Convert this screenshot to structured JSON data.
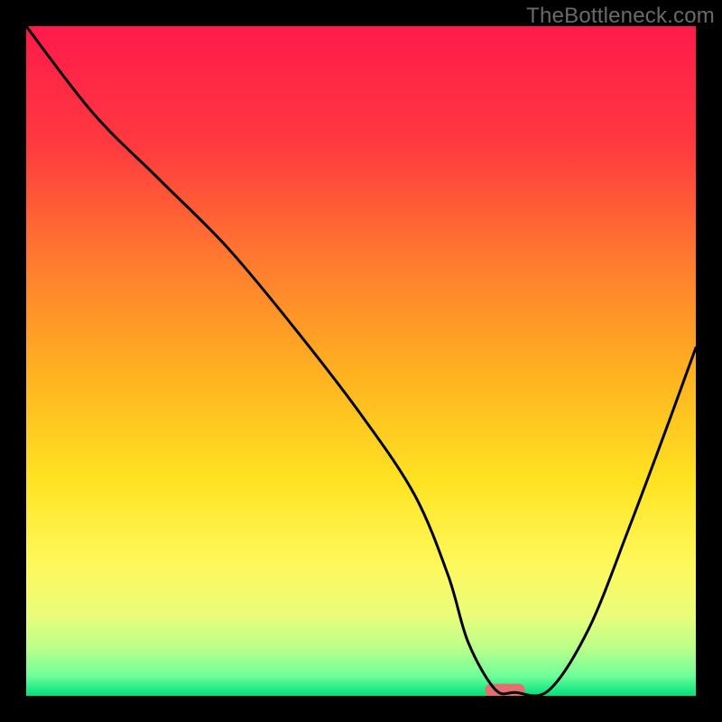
{
  "watermark": "TheBottleneck.com",
  "chart_data": {
    "type": "line",
    "title": "",
    "xlabel": "",
    "ylabel": "",
    "xlim": [
      0,
      100
    ],
    "ylim": [
      0,
      100
    ],
    "grid": false,
    "background_gradient_stops": [
      {
        "offset": 0.0,
        "color": "#ff1a4b"
      },
      {
        "offset": 0.18,
        "color": "#ff3a3f"
      },
      {
        "offset": 0.35,
        "color": "#ff7a2f"
      },
      {
        "offset": 0.52,
        "color": "#ffb220"
      },
      {
        "offset": 0.68,
        "color": "#ffe322"
      },
      {
        "offset": 0.8,
        "color": "#fff85a"
      },
      {
        "offset": 0.88,
        "color": "#eafd7a"
      },
      {
        "offset": 0.93,
        "color": "#b8ff8a"
      },
      {
        "offset": 0.97,
        "color": "#6fff9a"
      },
      {
        "offset": 1.0,
        "color": "#00e07a"
      }
    ],
    "series": [
      {
        "name": "bottleneck-curve",
        "x": [
          0,
          10,
          20,
          30,
          40,
          50,
          58,
          63,
          66,
          70,
          73,
          78,
          84,
          90,
          96,
          100
        ],
        "values": [
          100,
          87,
          77,
          67,
          55,
          42,
          30,
          18,
          8,
          1,
          0.5,
          0.8,
          10,
          25,
          41,
          52
        ]
      }
    ],
    "marker": {
      "name": "optimal-zone",
      "x_center": 71.5,
      "y_center": 0.8,
      "width": 6.0,
      "height": 2.0,
      "color": "#e36f6f"
    }
  }
}
